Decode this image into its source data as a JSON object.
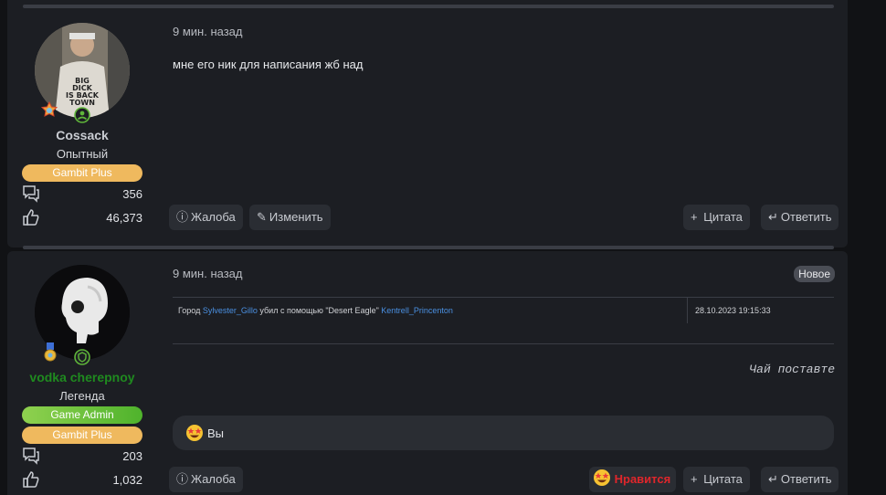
{
  "posts": [
    {
      "username": "Cossack",
      "rank": "Опытный",
      "groups": [
        "Gambit Plus"
      ],
      "messages_count": "356",
      "reactions_count": "46,373",
      "time": "9 мин. назад",
      "message": "мне его ник для написания жб над",
      "avatar_caption": "BIG DICK IS BACK TOWN",
      "actions": {
        "report": "Жалоба",
        "edit": "Изменить",
        "quote": "Цитата",
        "reply": "Ответить"
      }
    },
    {
      "username": "vodka cherepnoy",
      "rank": "Легенда",
      "groups": [
        "Game Admin",
        "Gambit Plus"
      ],
      "messages_count": "203",
      "reactions_count": "1,032",
      "time": "9 мин. назад",
      "new_badge": "Новое",
      "log": {
        "prefix": "Город",
        "killer": "Sylvester_Gillo",
        "middle": "убил с помощью \"Desert Eagle\"",
        "victim": "Kentrell_Princenton",
        "date": "28.10.2023 19:15:33"
      },
      "signature": "Чай поставте",
      "reaction_who": "Вы",
      "actions": {
        "report": "Жалоба",
        "like": "Нравится",
        "quote": "Цитата",
        "reply": "Ответить"
      }
    }
  ],
  "colors": {
    "background": "#111215",
    "card": "#1c1e23",
    "button": "#2a2d33",
    "gold_pill": "#efb95e",
    "green_pill": "#6cc23c",
    "admin_name": "#1f8a1f",
    "link": "#4a90e2",
    "like": "#e0262b"
  },
  "icons": [
    "messages-icon",
    "thumbs-up-icon",
    "warning-circle-icon",
    "pencil-icon",
    "plus-icon",
    "reply-arrow-icon",
    "star-eyes-emoji-icon",
    "online-status-icon",
    "medal-icon",
    "shield-icon"
  ]
}
